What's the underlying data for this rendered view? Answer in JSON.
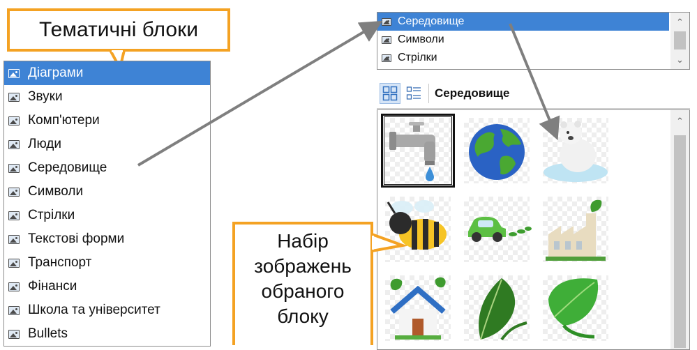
{
  "callouts": {
    "top": "Тематичні блоки",
    "middle": [
      "Набір",
      "зображень",
      "обраного",
      "блоку"
    ]
  },
  "categories": [
    {
      "label": "Діаграми",
      "selected": true
    },
    {
      "label": "Звуки"
    },
    {
      "label": "Комп'ютери"
    },
    {
      "label": "Люди"
    },
    {
      "label": "Середовище"
    },
    {
      "label": "Символи"
    },
    {
      "label": "Стрілки"
    },
    {
      "label": "Текстові форми"
    },
    {
      "label": "Транспорт"
    },
    {
      "label": "Фінанси"
    },
    {
      "label": "Школа та університет"
    },
    {
      "label": "Bullets"
    }
  ],
  "dropdown": {
    "items": [
      {
        "label": "Середовище",
        "selected": true
      },
      {
        "label": "Символи"
      },
      {
        "label": "Стрілки"
      }
    ]
  },
  "view_bar": {
    "title": "Середовище",
    "modes": [
      "large-icons-view",
      "details-view"
    ],
    "active_mode": "large-icons-view"
  },
  "gallery": {
    "images": [
      {
        "name": "faucet",
        "selected": true
      },
      {
        "name": "earth-globe"
      },
      {
        "name": "polar-bear-on-ice"
      },
      {
        "name": "bee"
      },
      {
        "name": "green-car"
      },
      {
        "name": "factory-with-leaves"
      },
      {
        "name": "house-with-leaves"
      },
      {
        "name": "green-leaf-sprout"
      },
      {
        "name": "green-leaf"
      }
    ]
  },
  "colors": {
    "callout_border": "#f4a223",
    "selection": "#3e83d5",
    "arrow": "#7f7f7f"
  }
}
